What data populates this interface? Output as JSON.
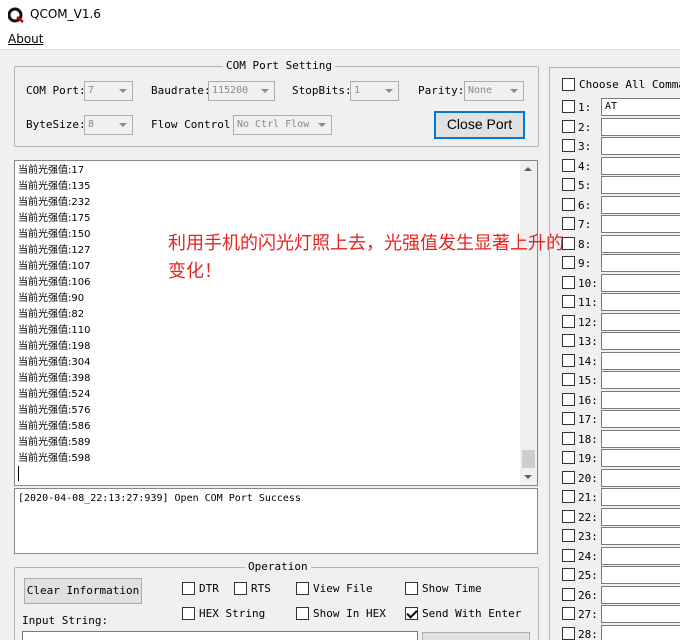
{
  "window": {
    "title": "QCOM_V1.6",
    "icon": "qcom-logo-icon"
  },
  "menu": {
    "about": "About"
  },
  "com_port_setting": {
    "title": "COM Port Setting",
    "com_port_label": "COM Port:",
    "com_port_value": "7",
    "baudrate_label": "Baudrate:",
    "baudrate_value": "115200",
    "stopbits_label": "StopBits:",
    "stopbits_value": "1",
    "parity_label": "Parity:",
    "parity_value": "None",
    "bytesize_label": "ByteSize:",
    "bytesize_value": "8",
    "flow_control_label": "Flow Control:",
    "flow_control_value": "No Ctrl Flow",
    "close_port_button": "Close Port"
  },
  "receive_log": {
    "lines": [
      "当前光强值:17",
      "当前光强值:135",
      "当前光强值:232",
      "当前光强值:175",
      "当前光强值:150",
      "当前光强值:127",
      "当前光强值:107",
      "当前光强值:106",
      "当前光强值:90",
      "当前光强值:82",
      "当前光强值:110",
      "当前光强值:198",
      "当前光强值:304",
      "当前光强值:398",
      "当前光强值:524",
      "当前光强值:576",
      "当前光强值:586",
      "当前光强值:589",
      "当前光强值:598"
    ]
  },
  "annotation": {
    "text": "利用手机的闪光灯照上去，光强值发生显著上升的变化！",
    "color": "#e8231f"
  },
  "status": {
    "text": "[2020-04-08_22:13:27:939] Open COM Port Success"
  },
  "operation": {
    "title": "Operation",
    "clear_button": "Clear Information",
    "dtr": {
      "label": "DTR",
      "checked": false
    },
    "rts": {
      "label": "RTS",
      "checked": false
    },
    "view_file": {
      "label": "View File",
      "checked": false
    },
    "show_time": {
      "label": "Show Time",
      "checked": false
    },
    "hex_string": {
      "label": "HEX String",
      "checked": false
    },
    "show_in_hex": {
      "label": "Show In HEX",
      "checked": false
    },
    "send_with_enter": {
      "label": "Send With Enter",
      "checked": true
    },
    "input_string_label": "Input String:",
    "input_string_value": ""
  },
  "commands": {
    "choose_all_label": "Choose All Comman",
    "choose_all_checked": false,
    "items": [
      {
        "num": "1:",
        "value": "AT"
      },
      {
        "num": "2:",
        "value": ""
      },
      {
        "num": "3:",
        "value": ""
      },
      {
        "num": "4:",
        "value": ""
      },
      {
        "num": "5:",
        "value": ""
      },
      {
        "num": "6:",
        "value": ""
      },
      {
        "num": "7:",
        "value": ""
      },
      {
        "num": "8:",
        "value": ""
      },
      {
        "num": "9:",
        "value": ""
      },
      {
        "num": "10:",
        "value": ""
      },
      {
        "num": "11:",
        "value": ""
      },
      {
        "num": "12:",
        "value": ""
      },
      {
        "num": "13:",
        "value": ""
      },
      {
        "num": "14:",
        "value": ""
      },
      {
        "num": "15:",
        "value": ""
      },
      {
        "num": "16:",
        "value": ""
      },
      {
        "num": "17:",
        "value": ""
      },
      {
        "num": "18:",
        "value": ""
      },
      {
        "num": "19:",
        "value": ""
      },
      {
        "num": "20:",
        "value": ""
      },
      {
        "num": "21:",
        "value": ""
      },
      {
        "num": "22:",
        "value": ""
      },
      {
        "num": "23:",
        "value": ""
      },
      {
        "num": "24:",
        "value": ""
      },
      {
        "num": "25:",
        "value": ""
      },
      {
        "num": "26:",
        "value": ""
      },
      {
        "num": "27:",
        "value": ""
      },
      {
        "num": "28:",
        "value": ""
      }
    ]
  }
}
